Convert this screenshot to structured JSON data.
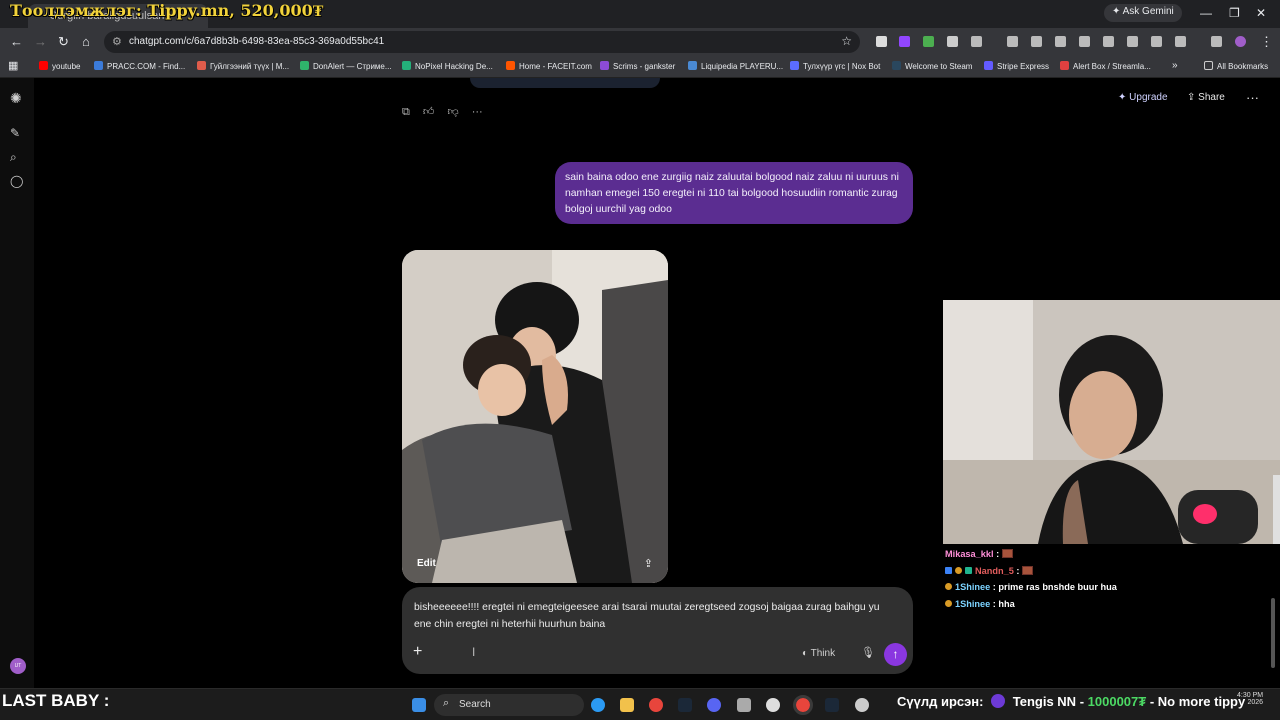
{
  "stream_overlay": {
    "title": "Тоолдэмжлэг: Tippy.mn, 520,000₮",
    "footer_left": "LAST BABY :",
    "ticker_label": "Сүүлд ирсэн:",
    "ticker_name": "Tengis NN",
    "ticker_amount": "1000007₮",
    "ticker_tail": "- No more tippy"
  },
  "browser": {
    "tab_title": "Surgiin baraligdsuulsan",
    "ask_gemini": "Ask Gemini",
    "url": "chatgpt.com/c/6a7d8b3b-6498-83ea-85c3-369a0d55bc41",
    "bookmarks": [
      {
        "label": "youtube",
        "color": "#ff0000"
      },
      {
        "label": "PRACC.COM - Find...",
        "color": "#3b7bd9"
      },
      {
        "label": "Гуйлгээний түүх | M...",
        "color": "#e05c4b"
      },
      {
        "label": "DonAlert — Стриме...",
        "color": "#2fb36b"
      },
      {
        "label": "NoPixel Hacking De...",
        "color": "#24b07a"
      },
      {
        "label": "Home - FACEIT.com",
        "color": "#ff5500"
      },
      {
        "label": "Scrims - gankster",
        "color": "#8d4bd6"
      },
      {
        "label": "Liquipedia PLAYERU...",
        "color": "#4a8ad4"
      },
      {
        "label": "Тулхүүр үгс | Nox Bot",
        "color": "#5b6cff"
      },
      {
        "label": "Welcome to Steam",
        "color": "#2a475e"
      },
      {
        "label": "Stripe Express",
        "color": "#635bff"
      },
      {
        "label": "Alert Box / Streamla...",
        "color": "#e04040"
      }
    ],
    "all_bookmarks": "All Bookmarks"
  },
  "chatgpt": {
    "upgrade_label": "Upgrade",
    "share_label": "Share",
    "rail_avatar": "UT",
    "user_message": "sain baina odoo ene zurgiig naiz zaluutai bolgood naiz zaluu ni uuruus ni namhan emegei 150 eregtei ni 110 tai bolgood hosuudiin romantic zurag bolgoj uurchil yag odoo",
    "image_edit_label": "Edit",
    "composer_text": "bisheeeeee!!!! eregtei ni emegteigeesee arai tsarai muutai zeregtseed zogsoj baigaa zurag baihgu yu ene chin eregtei ni heterhii huurhun baina",
    "think_label": "Think"
  },
  "stream_chat": [
    {
      "user": "Mikasa_kkl",
      "user_color": "#ff8fd8",
      "msg": "",
      "emote": true,
      "badges": 0
    },
    {
      "user": "Nandn_5",
      "user_color": "#e25d5d",
      "msg": "",
      "emote": true,
      "badges": 3
    },
    {
      "user": "1Shinee",
      "user_color": "#7cd3ff",
      "msg": "prime ras bnshde buur hua",
      "emote": false,
      "badges": 1
    },
    {
      "user": "1Shinee",
      "user_color": "#7cd3ff",
      "msg": "hha",
      "emote": false,
      "badges": 1
    }
  ],
  "taskbar": {
    "search_label": "Search",
    "time": "4:30 PM",
    "date": "2026"
  }
}
